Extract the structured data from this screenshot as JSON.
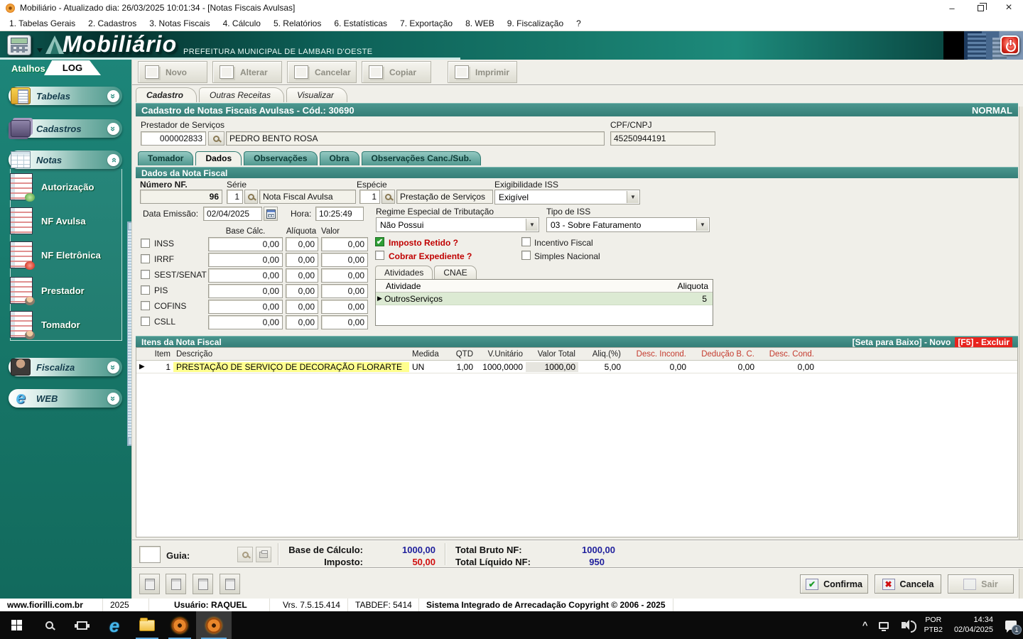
{
  "titlebar": {
    "title": "Mobiliário - Atualizado dia: 26/03/2025 10:01:34 - [Notas Fiscais Avulsas]"
  },
  "menubar": {
    "items": [
      "1. Tabelas Gerais",
      "2. Cadastros",
      "3. Notas Fiscais",
      "4. Cálculo",
      "5. Relatórios",
      "6. Estatísticas",
      "7. Exportação",
      "8. WEB",
      "9. Fiscalização",
      "?"
    ]
  },
  "brand": {
    "logo": "Mobiliário",
    "subtitle": "PREFEITURA MUNICIPAL DE LAMBARI D'OESTE"
  },
  "sidebar": {
    "atalhos": "Atalhos",
    "log": "LOG",
    "tabelas": "Tabelas",
    "cadastros": "Cadastros",
    "notas": "Notas",
    "notas_items": {
      "autorizacao": "Autorização",
      "nf_avulsa": "NF Avulsa",
      "nf_eletronica": "NF Eletrônica",
      "prestador": "Prestador",
      "tomador": "Tomador"
    },
    "fiscaliza": "Fiscaliza",
    "web": "WEB"
  },
  "toolbar": {
    "novo": "Novo",
    "alterar": "Alterar",
    "cancelar": "Cancelar",
    "copiar": "Copiar",
    "imprimir": "Imprimir"
  },
  "view_tabs": {
    "cadastro": "Cadastro",
    "outras": "Outras Receitas",
    "visualizar": "Visualizar"
  },
  "record": {
    "title": "Cadastro de Notas Fiscais Avulsas - Cód.: 30690",
    "status": "NORMAL",
    "prestador_label": "Prestador de Serviços",
    "prestador_code": "000002833",
    "prestador_name": "PEDRO BENTO ROSA",
    "cpf_label": "CPF/CNPJ",
    "cpf_value": "45250944191"
  },
  "detail_tabs": {
    "tomador": "Tomador",
    "dados": "Dados",
    "observacoes": "Observações",
    "obra": "Obra",
    "obs_canc": "Observações Canc./Sub."
  },
  "dados": {
    "section_title": "Dados da Nota Fiscal",
    "numero_label": "Número NF.",
    "numero": "96",
    "serie_label": "Série",
    "serie": "1",
    "serie_desc": "Nota Fiscal Avulsa",
    "especie_label": "Espécie",
    "especie": "1",
    "especie_desc": "Prestação de Serviços",
    "exig_label": "Exigibilidade ISS",
    "exig_value": "Exigível",
    "data_label": "Data Emissão:",
    "data": "02/04/2025",
    "hora_label": "Hora:",
    "hora": "10:25:49",
    "regime_label": "Regime Especial de Tributação",
    "regime": "Não Possui",
    "tipo_iss_label": "Tipo de ISS",
    "tipo_iss": "03 - Sobre Faturamento",
    "grid_headers": {
      "base": "Base Cálc.",
      "aliquota": "Alíquota",
      "valor": "Valor"
    },
    "taxes": [
      {
        "label": "INSS",
        "base": "0,00",
        "aliq": "0,00",
        "valor": "0,00"
      },
      {
        "label": "IRRF",
        "base": "0,00",
        "aliq": "0,00",
        "valor": "0,00"
      },
      {
        "label": "SEST/SENAT",
        "base": "0,00",
        "aliq": "0,00",
        "valor": "0,00"
      },
      {
        "label": "PIS",
        "base": "0,00",
        "aliq": "0,00",
        "valor": "0,00"
      },
      {
        "label": "COFINS",
        "base": "0,00",
        "aliq": "0,00",
        "valor": "0,00"
      },
      {
        "label": "CSLL",
        "base": "0,00",
        "aliq": "0,00",
        "valor": "0,00"
      }
    ],
    "imposto_retido": "Imposto Retido ?",
    "check_mark": "✔",
    "incentivo": "Incentivo Fiscal",
    "cobrar_expediente": "Cobrar Expediente ?",
    "simples": "Simples Nacional",
    "atividades_tab": "Atividades",
    "cnae_tab": "CNAE",
    "atividade_col": "Atividade",
    "aliquota_col": "Aliquota",
    "atividade_row": {
      "marker": "▶",
      "nome": "OutrosServiços",
      "aliquota": "5"
    }
  },
  "itens": {
    "section_title": "Itens da Nota Fiscal",
    "hint_novo": "[Seta para Baixo] - Novo",
    "hint_excluir": "[F5] - Excluir",
    "columns": [
      "Item",
      "Descrição",
      "Medida",
      "QTD",
      "V.Unitário",
      "Valor Total",
      "Aliq.(%)",
      "Desc. Incond.",
      "Dedução B. C.",
      "Desc. Cond."
    ],
    "row_marker": "▶",
    "rows": [
      {
        "item": "1",
        "descricao": "PRESTAÇÃO DE SERVIÇO DE DECORAÇÃO FLORARTE",
        "medida": "UN",
        "qtd": "1,00",
        "v_unitario": "1000,0000",
        "valor_total": "1000,00",
        "aliq": "5,00",
        "desc_incond": "0,00",
        "deducao": "0,00",
        "desc_cond": "0,00"
      }
    ]
  },
  "totais": {
    "guia_label": "Guia:",
    "base_label": "Base de Cálculo:",
    "base": "1000,00",
    "imposto_label": "Imposto:",
    "imposto": "50,00",
    "bruto_label": "Total Bruto NF:",
    "bruto": "1000,00",
    "liquido_label": "Total Líquido NF:",
    "liquido": "950"
  },
  "actions": {
    "confirma": "Confirma",
    "cancela": "Cancela",
    "sair": "Sair",
    "confirma_icon": "✔",
    "cancela_icon": "✖"
  },
  "statusbar": {
    "site": "www.fiorilli.com.br",
    "ano": "2025",
    "usuario": "Usuário: RAQUEL",
    "versao": "Vrs. 7.5.15.414",
    "tabdef": "TABDEF: 5414",
    "copyright": "Sistema Integrado de Arrecadação Copyright © 2006 - 2025"
  },
  "taskbar": {
    "chevron": "^",
    "lang1": "POR",
    "lang2": "PTB2",
    "time": "14:34",
    "date": "02/04/2025",
    "badge": "1"
  },
  "colors": {
    "teal_header": "#3a8e86",
    "sidebar_teal": "#177466",
    "accent_red": "#cc0000",
    "value_navy": "#1f1f9c",
    "highlight_yellow": "#ffff8e",
    "row_green": "#dcead3"
  }
}
